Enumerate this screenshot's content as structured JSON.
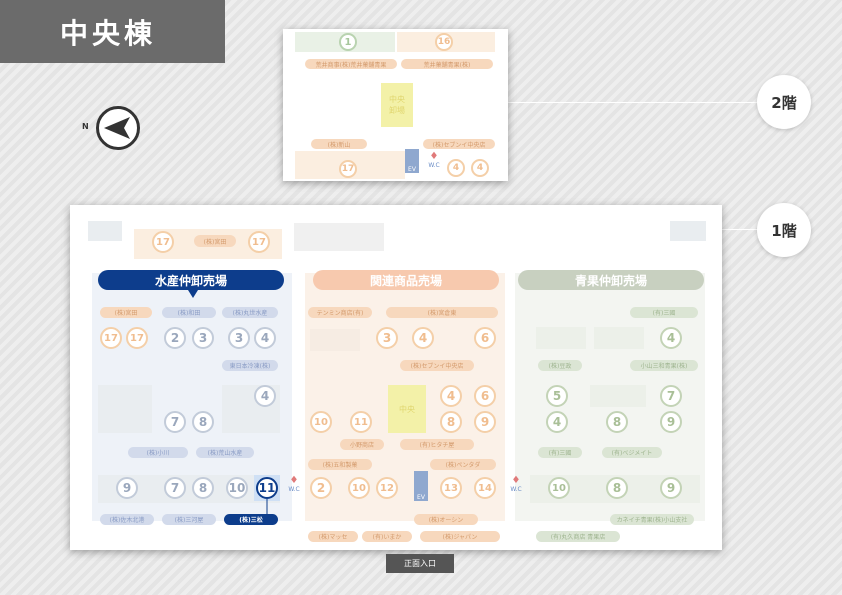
{
  "building_title": "中央棟",
  "compass": {
    "label": "N"
  },
  "floors": [
    {
      "label": "2階"
    },
    {
      "label": "1階"
    }
  ],
  "floor2": {
    "numbers": [
      "1",
      "16",
      "17",
      "4",
      "4"
    ],
    "labels": [
      "荒井商事(株)荒井菓舗青果",
      "荒井菓舗青果(株)",
      "(株)新山",
      "(株)セブンイ中央店"
    ],
    "center": "中央\n卸場",
    "ev": "EV",
    "wc": "W.C"
  },
  "floor1": {
    "top_numbers": [
      "17",
      "17"
    ],
    "top_labels": [
      "(株)宮田"
    ],
    "sections": [
      {
        "title": "水産仲卸売場",
        "color": "#0d3d8c"
      },
      {
        "title": "関連商品売場",
        "color": "#f2a27a"
      },
      {
        "title": "青果仲卸売場",
        "color": "#a8b59c"
      }
    ],
    "seafood": {
      "labels": [
        "(株)宮田",
        "(株)和田",
        "(株)丸世水産",
        "東日本冷凍(株)",
        "(株)小川",
        "(株)荒山水産",
        "(株)佐木北港",
        "(株)三河屋",
        "(株)三松"
      ],
      "numbers": [
        "17",
        "17",
        "2",
        "3",
        "3",
        "4",
        "4",
        "7",
        "8",
        "9",
        "7",
        "8",
        "10",
        "11"
      ]
    },
    "related": {
      "labels": [
        "テンミン商店(有)",
        "(株)宮倉東",
        "(株)セブンイ中央店",
        "小野商店",
        "(有)ヒタチ屋",
        "(株)五和製菓",
        "(株)ペンタダ",
        "(株)オーシン",
        "(株)マッセ",
        "(有)いまか",
        "(株)ジャパン"
      ],
      "numbers": [
        "3",
        "4",
        "6",
        "4",
        "6",
        "10",
        "11",
        "8",
        "9",
        "2",
        "10",
        "12",
        "13",
        "14"
      ],
      "center": "中央"
    },
    "produce": {
      "labels": [
        "(有)三國",
        "小山三和青果(株)",
        "(株)豆政",
        "(有)三國",
        "(有)べジメイト",
        "カネイチ青果(株)小山支社",
        "(有)丸久商店 青果店"
      ],
      "numbers": [
        "4",
        "5",
        "7",
        "4",
        "8",
        "9",
        "10",
        "8",
        "9"
      ]
    },
    "ev": "EV",
    "wc": "W.C",
    "highlight_number": "11"
  },
  "entrance": "正面入口"
}
